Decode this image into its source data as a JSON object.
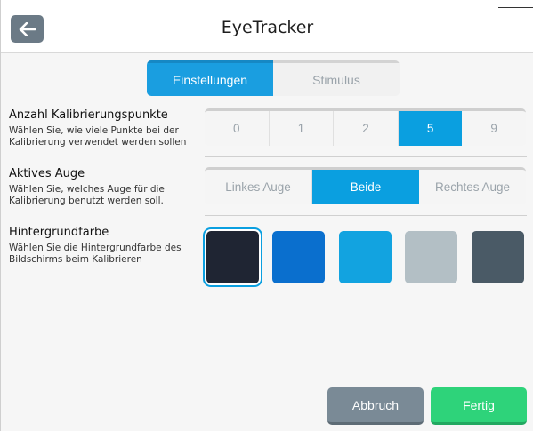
{
  "app": {
    "title": "EyeTracker"
  },
  "tabs": [
    {
      "label": "Einstellungen",
      "active": true
    },
    {
      "label": "Stimulus",
      "active": false
    }
  ],
  "calibration_points": {
    "title": "Anzahl Kalibrierungspunkte",
    "description": "Wählen Sie, wie viele Punkte bei der Kalibrierung verwendet werden sollen",
    "options": [
      "0",
      "1",
      "2",
      "5",
      "9"
    ],
    "selected": "5"
  },
  "active_eye": {
    "title": "Aktives Auge",
    "description": "Wählen Sie, welches Auge für die Kalibrierung benutzt werden soll.",
    "options": [
      "Linkes Auge",
      "Beide",
      "Rechtes Auge"
    ],
    "selected": "Beide"
  },
  "background_color": {
    "title": "Hintergrundfarbe",
    "description": "Wählen Sie die Hintergrundfarbe des Bildschirms beim Kalibrieren",
    "swatches": [
      "#1f2533",
      "#0a6fce",
      "#12a3e0",
      "#b3bfc5",
      "#4a5a66"
    ],
    "selected_index": 0
  },
  "buttons": {
    "cancel": "Abbruch",
    "done": "Fertig"
  },
  "colors": {
    "accent": "#0a9fe0",
    "back_button": "#6b7a86",
    "done": "#2ed37a",
    "cancel": "#7a8a96"
  },
  "icons": {
    "back": "arrow-left-icon"
  }
}
